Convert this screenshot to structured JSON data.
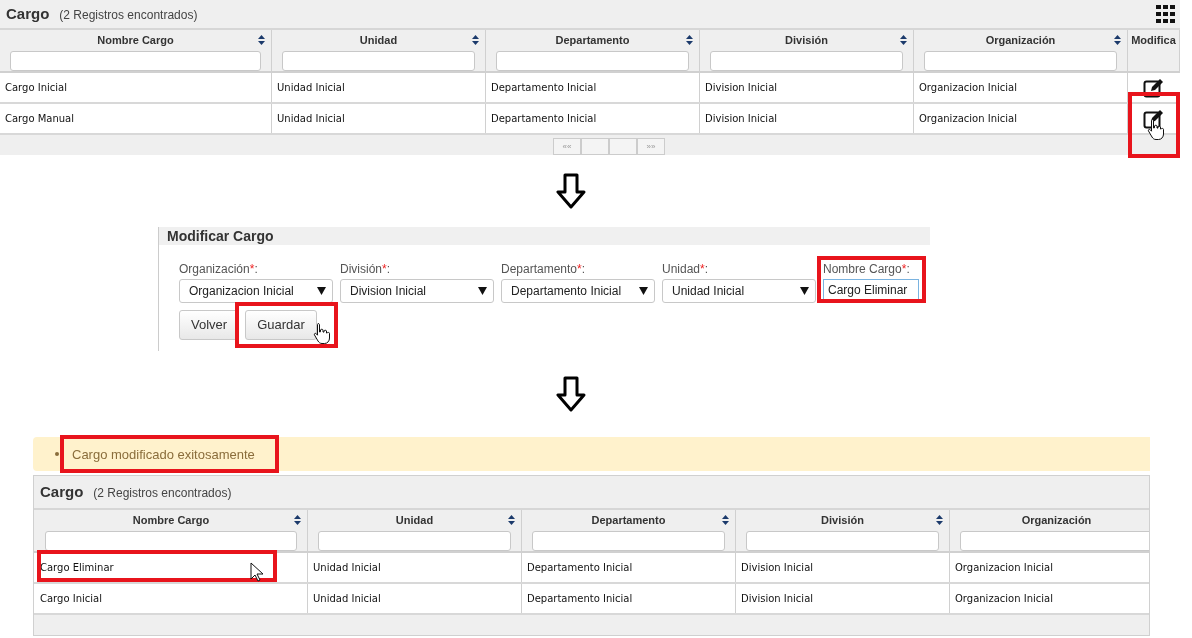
{
  "steps": [
    {
      "kind": "grid",
      "title": "Cargo",
      "count": "(2 Registros encontrados)",
      "columns_menu": true,
      "columns": [
        {
          "label": "Nombre Cargo",
          "sortable": true
        },
        {
          "label": "Unidad",
          "sortable": true
        },
        {
          "label": "Departamento",
          "sortable": true
        },
        {
          "label": "División",
          "sortable": true
        },
        {
          "label": "Organización",
          "sortable": true
        },
        {
          "label": "Modifica",
          "sortable": false
        }
      ],
      "rows": [
        {
          "cells": [
            "Cargo Inicial",
            "Unidad Inicial",
            "Departamento Inicial",
            "Division Inicial",
            "Organizacion Inicial"
          ],
          "edit_highlighted": false
        },
        {
          "cells": [
            "Cargo Manual",
            "Unidad Inicial",
            "Departamento Inicial",
            "Division Inicial",
            "Organizacion Inicial"
          ],
          "edit_highlighted": true
        }
      ],
      "pager": {
        "first": "««",
        "last": "»»"
      }
    },
    {
      "kind": "arrow"
    },
    {
      "kind": "form",
      "title": "Modificar Cargo",
      "fields": [
        {
          "kind": "select",
          "label": "Organización",
          "required_mark": "*",
          "suffix": ":",
          "value": "Organizacion Inicial",
          "highlighted": false
        },
        {
          "kind": "select",
          "label": "División",
          "required_mark": "*",
          "suffix": ":",
          "value": "Division Inicial",
          "highlighted": false
        },
        {
          "kind": "select",
          "label": "Departamento",
          "required_mark": "*",
          "suffix": ":",
          "value": "Departamento Inicial",
          "highlighted": false
        },
        {
          "kind": "select",
          "label": "Unidad",
          "required_mark": "*",
          "suffix": ":",
          "value": "Unidad Inicial",
          "highlighted": false
        },
        {
          "kind": "text",
          "label": "Nombre Cargo",
          "required_mark": "*",
          "suffix": ":",
          "value": "Cargo Eliminar",
          "highlighted": true
        }
      ],
      "buttons": [
        {
          "label": "Volver",
          "highlighted": false
        },
        {
          "label": "Guardar",
          "highlighted": true
        }
      ]
    },
    {
      "kind": "arrow"
    },
    {
      "kind": "message",
      "text": "Cargo modificado exitosamente",
      "highlighted": true
    },
    {
      "kind": "grid",
      "title": "Cargo",
      "count": "(2 Registros encontrados)",
      "columns_menu": false,
      "columns": [
        {
          "label": "Nombre Cargo",
          "sortable": true
        },
        {
          "label": "Unidad",
          "sortable": true
        },
        {
          "label": "Departamento",
          "sortable": true
        },
        {
          "label": "División",
          "sortable": true
        },
        {
          "label": "Organización",
          "sortable": false
        }
      ],
      "rows": [
        {
          "cells": [
            "Cargo Eliminar",
            "Unidad Inicial",
            "Departamento Inicial",
            "Division Inicial",
            "Organizacion Inicial"
          ],
          "first_cell_highlighted": true
        },
        {
          "cells": [
            "Cargo Inicial",
            "Unidad Inicial",
            "Departamento Inicial",
            "Division Inicial",
            "Organizacion Inicial"
          ],
          "first_cell_highlighted": false
        }
      ]
    }
  ]
}
